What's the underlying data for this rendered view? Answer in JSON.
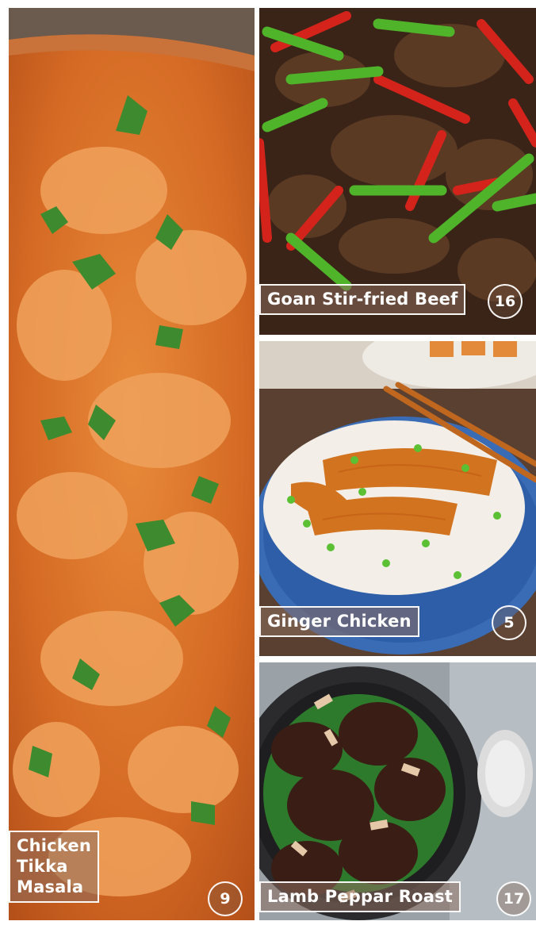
{
  "recipes": [
    {
      "name_lines": [
        "Chicken",
        "Tikka",
        "Masala"
      ],
      "page": "9"
    },
    {
      "name": "Goan Stir-fried Beef",
      "page": "16"
    },
    {
      "name": "Ginger Chicken",
      "page": "5"
    },
    {
      "name": "Lamb Peppar Roast",
      "page": "17"
    }
  ]
}
